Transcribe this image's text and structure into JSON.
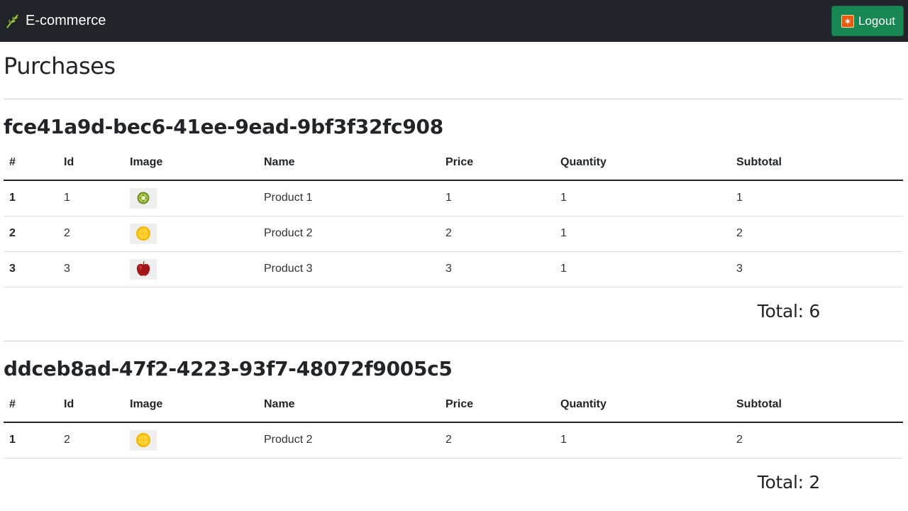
{
  "navbar": {
    "brand": "E-commerce",
    "brand_icon": "leaf-icon",
    "logout_label": "Logout",
    "logout_icon": "logout-icon",
    "background": "#212529",
    "button_color": "#198754"
  },
  "page": {
    "title": "Purchases"
  },
  "columns": [
    "#",
    "Id",
    "Image",
    "Name",
    "Price",
    "Quantity",
    "Subtotal"
  ],
  "orders": [
    {
      "id": "fce41a9d-bec6-41ee-9ead-9bf3f32fc908",
      "rows": [
        {
          "num": "1",
          "id": "1",
          "image": "kiwi-image",
          "name": "Product 1",
          "price": "1",
          "quantity": "1",
          "subtotal": "1"
        },
        {
          "num": "2",
          "id": "2",
          "image": "orange-image",
          "name": "Product 2",
          "price": "2",
          "quantity": "1",
          "subtotal": "2"
        },
        {
          "num": "3",
          "id": "3",
          "image": "apple-image",
          "name": "Product 3",
          "price": "3",
          "quantity": "1",
          "subtotal": "3"
        }
      ],
      "total": "Total: 6"
    },
    {
      "id": "ddceb8ad-47f2-4223-93f7-48072f9005c5",
      "rows": [
        {
          "num": "1",
          "id": "2",
          "image": "orange-image",
          "name": "Product 2",
          "price": "2",
          "quantity": "1",
          "subtotal": "2"
        }
      ],
      "total": "Total: 2"
    }
  ]
}
